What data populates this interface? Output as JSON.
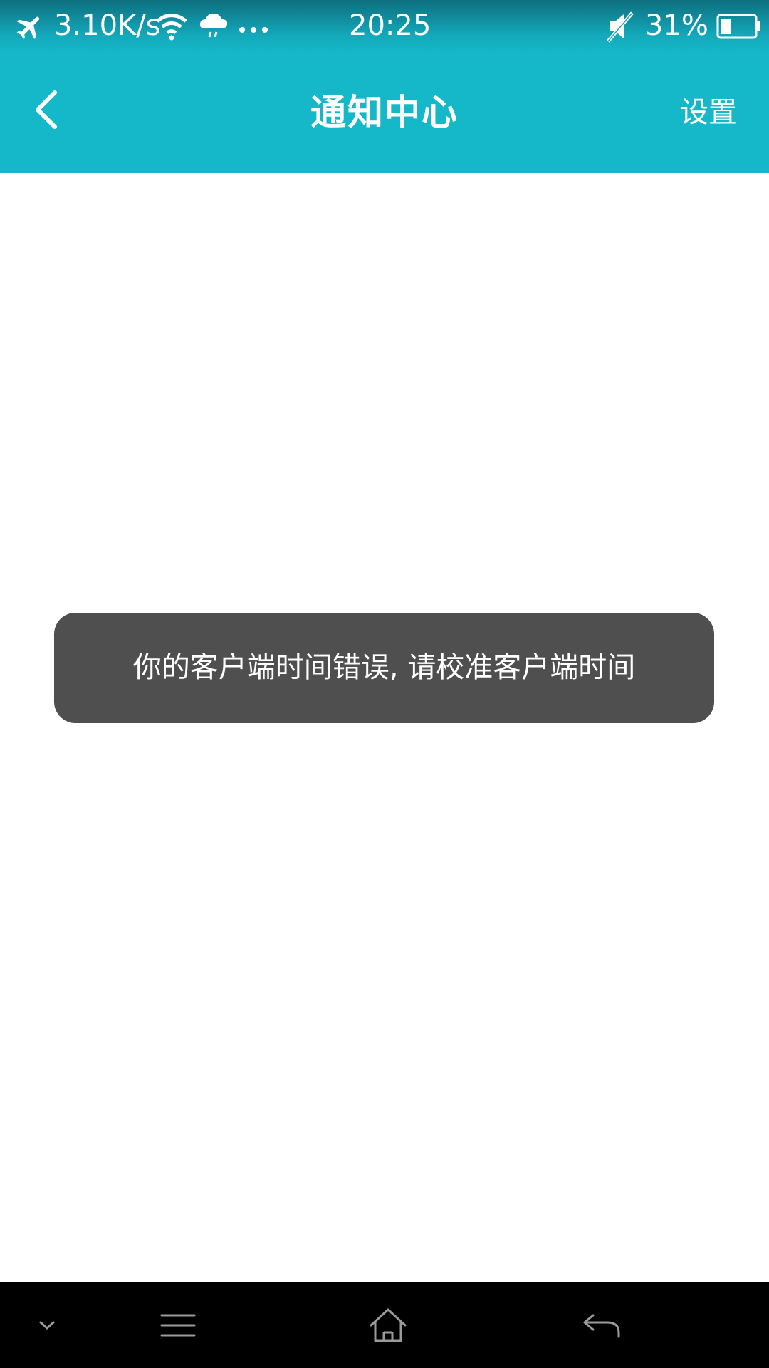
{
  "status_bar": {
    "network_speed": "3.10K/s",
    "time": "20:25",
    "battery_percent": "31%",
    "battery_level": 0.31,
    "icons": [
      "airplane-mode-icon",
      "wifi-icon",
      "weather-rain-icon",
      "more-dots-icon",
      "mute-icon",
      "battery-icon"
    ]
  },
  "app_bar": {
    "title": "通知中心",
    "settings_label": "设置",
    "back_icon": "chevron-left-icon"
  },
  "toast": {
    "message": "你的客户端时间错误, 请校准客户端时间"
  },
  "nav_bar": {
    "icons": [
      "collapse-icon",
      "menu-icon",
      "home-icon",
      "back-icon"
    ]
  },
  "colors": {
    "accent": "#14b8c8",
    "toast_bg": "#4f4f4f",
    "nav_bg": "#000000"
  }
}
